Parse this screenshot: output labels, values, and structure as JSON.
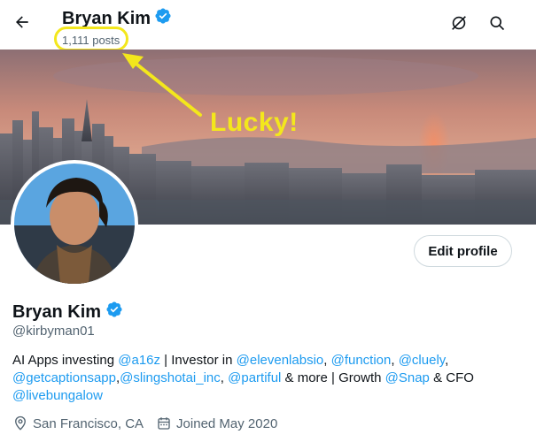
{
  "header": {
    "name": "Bryan Kim",
    "posts": "1,111 posts"
  },
  "annotation": {
    "text": "Lucky!",
    "color": "#f3e71c"
  },
  "profile": {
    "name": "Bryan Kim",
    "handle": "@kirbyman01",
    "edit_label": "Edit profile",
    "bio": {
      "t1": "AI Apps investing ",
      "l1": "@a16z",
      "t2": " | Investor in ",
      "l2": "@elevenlabsio",
      "t3": ", ",
      "l3": "@function",
      "t4": ", ",
      "l4": "@cluely",
      "t5": ", ",
      "l5": "@getcaptionsapp",
      "t6": ",",
      "l6": "@slingshotai_inc",
      "t7": ", ",
      "l7": "@partiful",
      "t8": " & more | Growth ",
      "l8": "@Snap",
      "t9": " & CFO ",
      "l9": "@livebungalow"
    },
    "location": "San Francisco, CA",
    "joined": "Joined May 2020"
  },
  "colors": {
    "link": "#1d9bf0",
    "verified": "#1d9bf0",
    "secondary_text": "#536471"
  },
  "icons": [
    "back-arrow-icon",
    "verified-badge-icon",
    "no-grok-icon",
    "search-icon",
    "location-pin-icon",
    "calendar-icon"
  ]
}
